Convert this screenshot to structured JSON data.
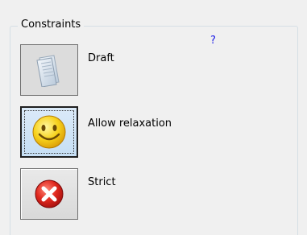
{
  "group": {
    "title": "Constraints",
    "help": "?"
  },
  "options": [
    {
      "label": "Draft",
      "icon": "draft-document-icon",
      "state": "pressed"
    },
    {
      "label": "Allow relaxation",
      "icon": "smiley-face-icon",
      "state": "selected"
    },
    {
      "label": "Strict",
      "icon": "red-x-error-icon",
      "state": "normal"
    }
  ],
  "colors": {
    "panel_bg": "#f0f0f0",
    "group_border": "#d5dfe5",
    "help_link": "#1a1ae6",
    "strict_red": "#d42020",
    "smiley_yellow": "#f7d21c"
  }
}
